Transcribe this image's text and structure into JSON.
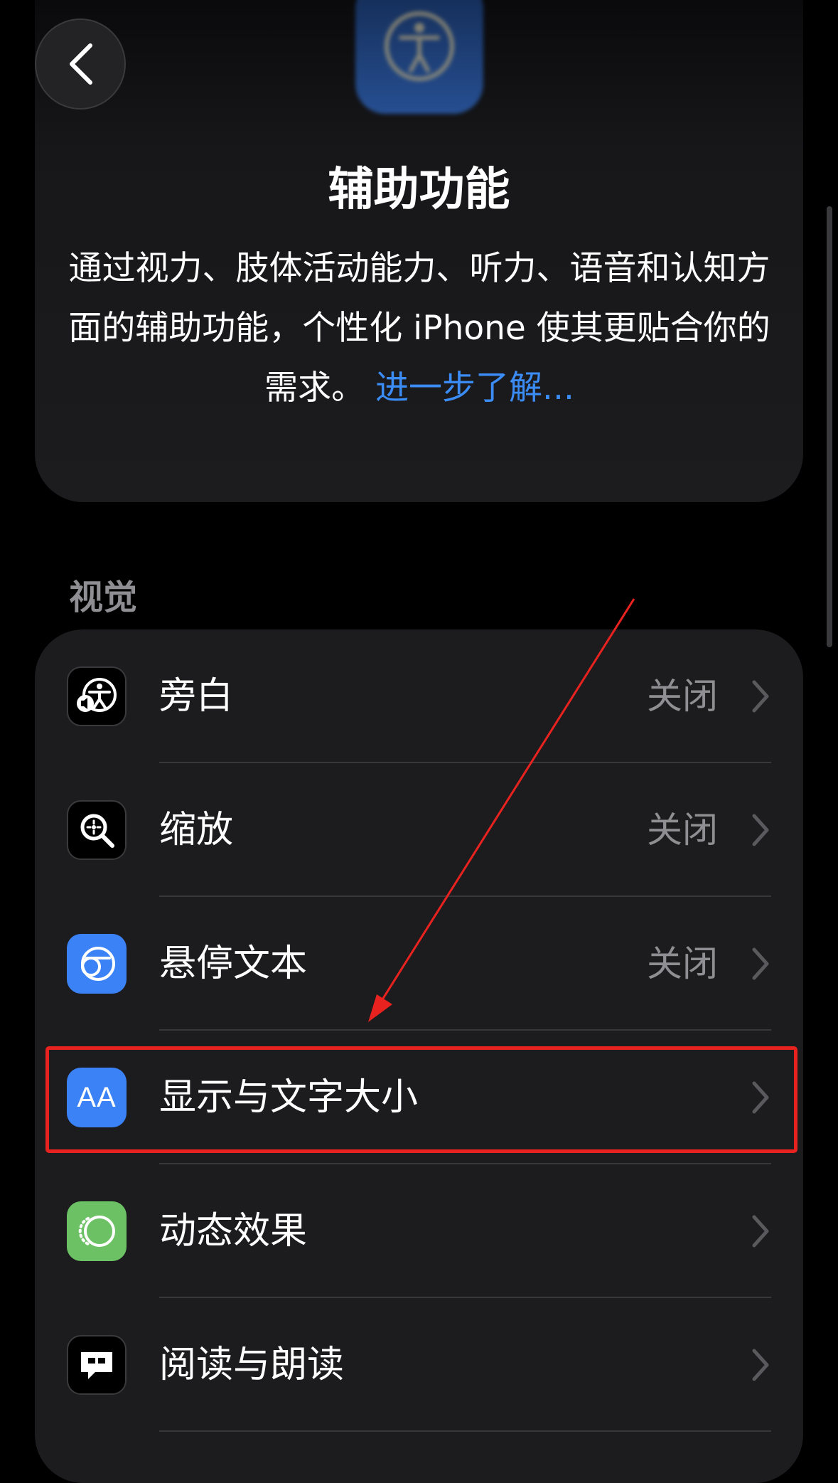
{
  "header": {
    "title": "辅助功能",
    "description": "通过视力、肢体活动能力、听力、语音和认知方面的辅助功能，个性化 iPhone 使其更贴合你的需求。",
    "learn_more_link": "进一步了解..."
  },
  "section": {
    "title": "视觉"
  },
  "rows": [
    {
      "label": "旁白",
      "value": "关闭",
      "icon": "voiceover-icon"
    },
    {
      "label": "缩放",
      "value": "关闭",
      "icon": "zoom-icon"
    },
    {
      "label": "悬停文本",
      "value": "关闭",
      "icon": "hover-text-icon"
    },
    {
      "label": "显示与文字大小",
      "value": "",
      "icon": "display-text-size-icon",
      "icon_text": "AA"
    },
    {
      "label": "动态效果",
      "value": "",
      "icon": "motion-icon"
    },
    {
      "label": "阅读与朗读",
      "value": "",
      "icon": "spoken-content-icon"
    }
  ],
  "colors": {
    "background": "#000000",
    "card": "#1c1c1e",
    "link": "#3b8cf4",
    "secondary_text": "#8e8e93",
    "annotation_red": "#e8221f",
    "icon_blue": "#3b82f6",
    "icon_green": "#6cc164"
  }
}
